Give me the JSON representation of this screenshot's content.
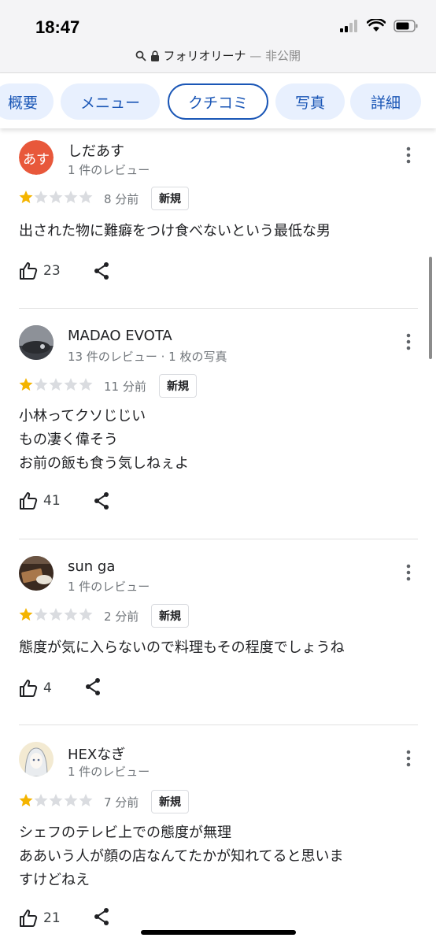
{
  "status": {
    "time": "18:47"
  },
  "browser": {
    "url_text": "フォリオリーナ",
    "url_suffix": " — 非公開"
  },
  "tabs": [
    {
      "label": "概要"
    },
    {
      "label": "メニュー"
    },
    {
      "label": "クチコミ",
      "active": true
    },
    {
      "label": "写真"
    },
    {
      "label": "詳細"
    }
  ],
  "reviews": [
    {
      "name": "しだあす",
      "avatar_text": "あす",
      "meta": "1 件のレビュー",
      "rating": 1,
      "ago": "8 分前",
      "badge": "新規",
      "text": "出された物に難癖をつけ食べないという最低な男",
      "likes": "23"
    },
    {
      "name": "MADAO EVOTA",
      "meta": "13 件のレビュー · 1 枚の写真",
      "rating": 1,
      "ago": "11 分前",
      "badge": "新規",
      "text": "小林ってクソじじい\nもの凄く偉そう\nお前の飯も食う気しねぇよ",
      "likes": "41"
    },
    {
      "name": "sun ga",
      "meta": "1 件のレビュー",
      "rating": 1,
      "ago": "2 分前",
      "badge": "新規",
      "text": "態度が気に入らないので料理もその程度でしょうね",
      "likes": "4"
    },
    {
      "name": "HEXなぎ",
      "meta": "1 件のレビュー",
      "rating": 1,
      "ago": "7 分前",
      "badge": "新規",
      "text": "シェフのテレビ上での態度が無理\nああいう人が顔の店なんてたかが知れてると思いま\nすけどねえ",
      "likes": "21"
    }
  ],
  "colors": {
    "accent": "#1a56b6",
    "tab_bg": "#e8f0fe",
    "star_filled": "#f4b400",
    "star_empty": "#dadce0",
    "avatar_orange": "#e8583b"
  },
  "icons": [
    "search-icon",
    "lock-icon",
    "more-vert-icon",
    "star-icon",
    "thumb-up-icon",
    "share-icon",
    "signal-icon",
    "wifi-icon",
    "battery-icon"
  ]
}
